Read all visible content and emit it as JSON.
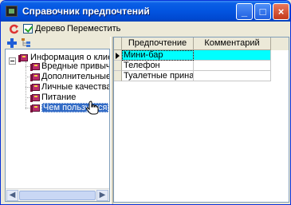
{
  "window": {
    "title": "Справочник предпочтений"
  },
  "titlebar": {
    "minimize_label": "_",
    "maximize_label": "□",
    "close_label": "×"
  },
  "toolbar": {
    "tree_checkbox_checked": true,
    "tree_label": "Дерево",
    "move_label": "Переместить"
  },
  "tree": {
    "root": "Информация о клиенте",
    "items": [
      "Вредные привычки",
      "Дополнительные услуги",
      "Личные качества",
      "Питание",
      "Чем пользуется"
    ],
    "selected_index": 4
  },
  "grid": {
    "columns": [
      "Предпочтение",
      "Комментарий"
    ],
    "rows": [
      {
        "pref": "Мини-бар",
        "comment": ""
      },
      {
        "pref": "Телефон",
        "comment": ""
      },
      {
        "pref": "Туалетные принадлежности",
        "comment": ""
      }
    ],
    "active_row": 0
  },
  "colors": {
    "title_bar": "#0254e0",
    "selection": "#316ac5",
    "active_row": "#00ffff",
    "book_icon": "#b72c6d"
  },
  "icons": [
    "refresh-icon",
    "add-icon",
    "tree-view-icon",
    "book-icon",
    "hand-cursor-icon"
  ]
}
